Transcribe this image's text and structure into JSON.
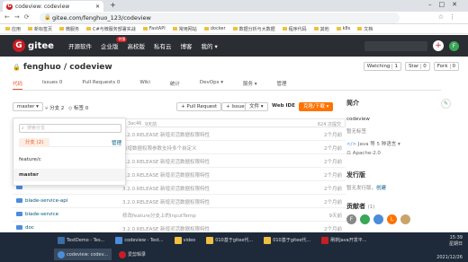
{
  "browser": {
    "tab_title": "codeview: codeview",
    "url": "gitee.com/fenghuo_123/codeview",
    "bookmarks": [
      "应用",
      "新标签页",
      "微服务",
      "C#与微服务部署实战",
      "FastAPI",
      "常用网站",
      "docker",
      "数据分析与大数据",
      "程序代码",
      "其他",
      "k8s",
      "文档"
    ]
  },
  "gitee_nav": {
    "logo_text": "gitee",
    "links": [
      "开源软件",
      "企业版",
      "高校版",
      "私有云",
      "博客",
      "我的 ▾"
    ],
    "enterprise_badge": "特惠",
    "avatar_letter": "F"
  },
  "repo": {
    "owner_repo": "fenghuo / codeview",
    "watching_label": "Watching",
    "watching_count": "1",
    "star_label": "Star",
    "star_count": "0",
    "fork_label": "Fork",
    "fork_count": "0",
    "tabs": [
      "代码",
      "Issues 0",
      "Pull Requests 0",
      "Wiki",
      "统计",
      "DevOps ▾",
      "服务 ▾",
      "管理"
    ]
  },
  "toolbar": {
    "branch": "master ▾",
    "branches": "分支 2",
    "tags": "标签 0",
    "pull_request": "+ Pull Request",
    "issue": "+ Issue",
    "file": "文件 ▾",
    "web_ide": "Web IDE",
    "clone": "克隆/下载 ▾"
  },
  "commit_bar": {
    "hash": "3ac46",
    "ago": "9天前",
    "commits": "624 次提交"
  },
  "dropdown": {
    "search_placeholder": "搜索分支",
    "tab_active": "分支 (2)",
    "manage": "管理",
    "branches": [
      "feature/c",
      "master"
    ]
  },
  "files": [
    {
      "name": "",
      "msg": "3.2.0.RELEASE 新增灵活数据权限特性",
      "time": "2个月前"
    },
    {
      "name": "",
      "msg": "新增数据权限参数支持多个自定义",
      "time": "2个月前"
    },
    {
      "name": "",
      "msg": "3.2.0.RELEASE 新增灵活数据权限特性",
      "time": "2个月前"
    },
    {
      "name": "",
      "msg": "3.2.0.RELEASE 新增灵活数据权限特性",
      "time": "2个月前"
    },
    {
      "name": "",
      "msg": "3.2.0.RELEASE 新增灵活数据权限特性",
      "time": "2个月前"
    },
    {
      "name": "blade-service-api",
      "msg": "3.2.0.RELEASE 新增灵活数据权限特性",
      "time": "2个月前"
    },
    {
      "name": "blade-service",
      "msg": "修改feature分支上的InputTemp",
      "time": "9天前"
    },
    {
      "name": "doc",
      "msg": "3.2.0.RELEASE 新增灵活数据权限特性",
      "time": "2个月前"
    }
  ],
  "sidebar": {
    "intro_title": "简介",
    "repo_name": "codeview",
    "no_tags": "暂无标签",
    "language": "Java 等 5 种语言 ▾",
    "license": "Apache-2.0",
    "release_title": "发行版",
    "no_release": "暂无发行版，",
    "create": "创建",
    "contrib_title": "贡献者",
    "contrib_count": "(1)",
    "contrib_letters": [
      "F",
      "",
      "",
      "L",
      ""
    ]
  },
  "taskbar": {
    "row1": [
      "TestDemo - Tes...",
      "codeview - Test...",
      "video",
      "010基于gitee代...",
      "010基于gitee代...",
      "刷新Java开发平..."
    ],
    "row2": [
      "codeview: codev...",
      "爱剪辑录"
    ],
    "time": "15:39",
    "date": "2021/12/26",
    "day": "星期日"
  }
}
